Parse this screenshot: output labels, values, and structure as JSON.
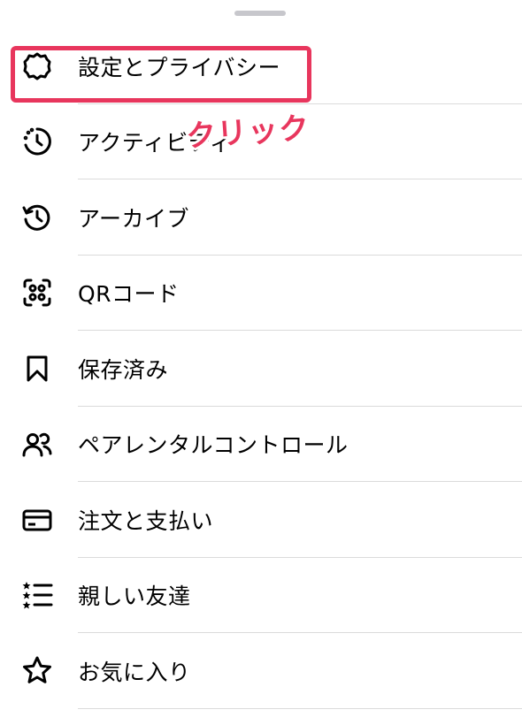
{
  "menu": {
    "items": [
      {
        "label": "設定とプライバシー",
        "icon": "settings-gear-icon"
      },
      {
        "label": "アクティビティ",
        "icon": "activity-icon"
      },
      {
        "label": "アーカイブ",
        "icon": "archive-icon"
      },
      {
        "label": "QRコード",
        "icon": "qr-code-icon"
      },
      {
        "label": "保存済み",
        "icon": "bookmark-icon"
      },
      {
        "label": "ペアレンタルコントロール",
        "icon": "parental-controls-icon"
      },
      {
        "label": "注文と支払い",
        "icon": "credit-card-icon"
      },
      {
        "label": "親しい友達",
        "icon": "close-friends-list-icon"
      },
      {
        "label": "お気に入り",
        "icon": "star-icon"
      }
    ]
  },
  "annotation": {
    "text": "クリック",
    "color": "#e8365d"
  }
}
